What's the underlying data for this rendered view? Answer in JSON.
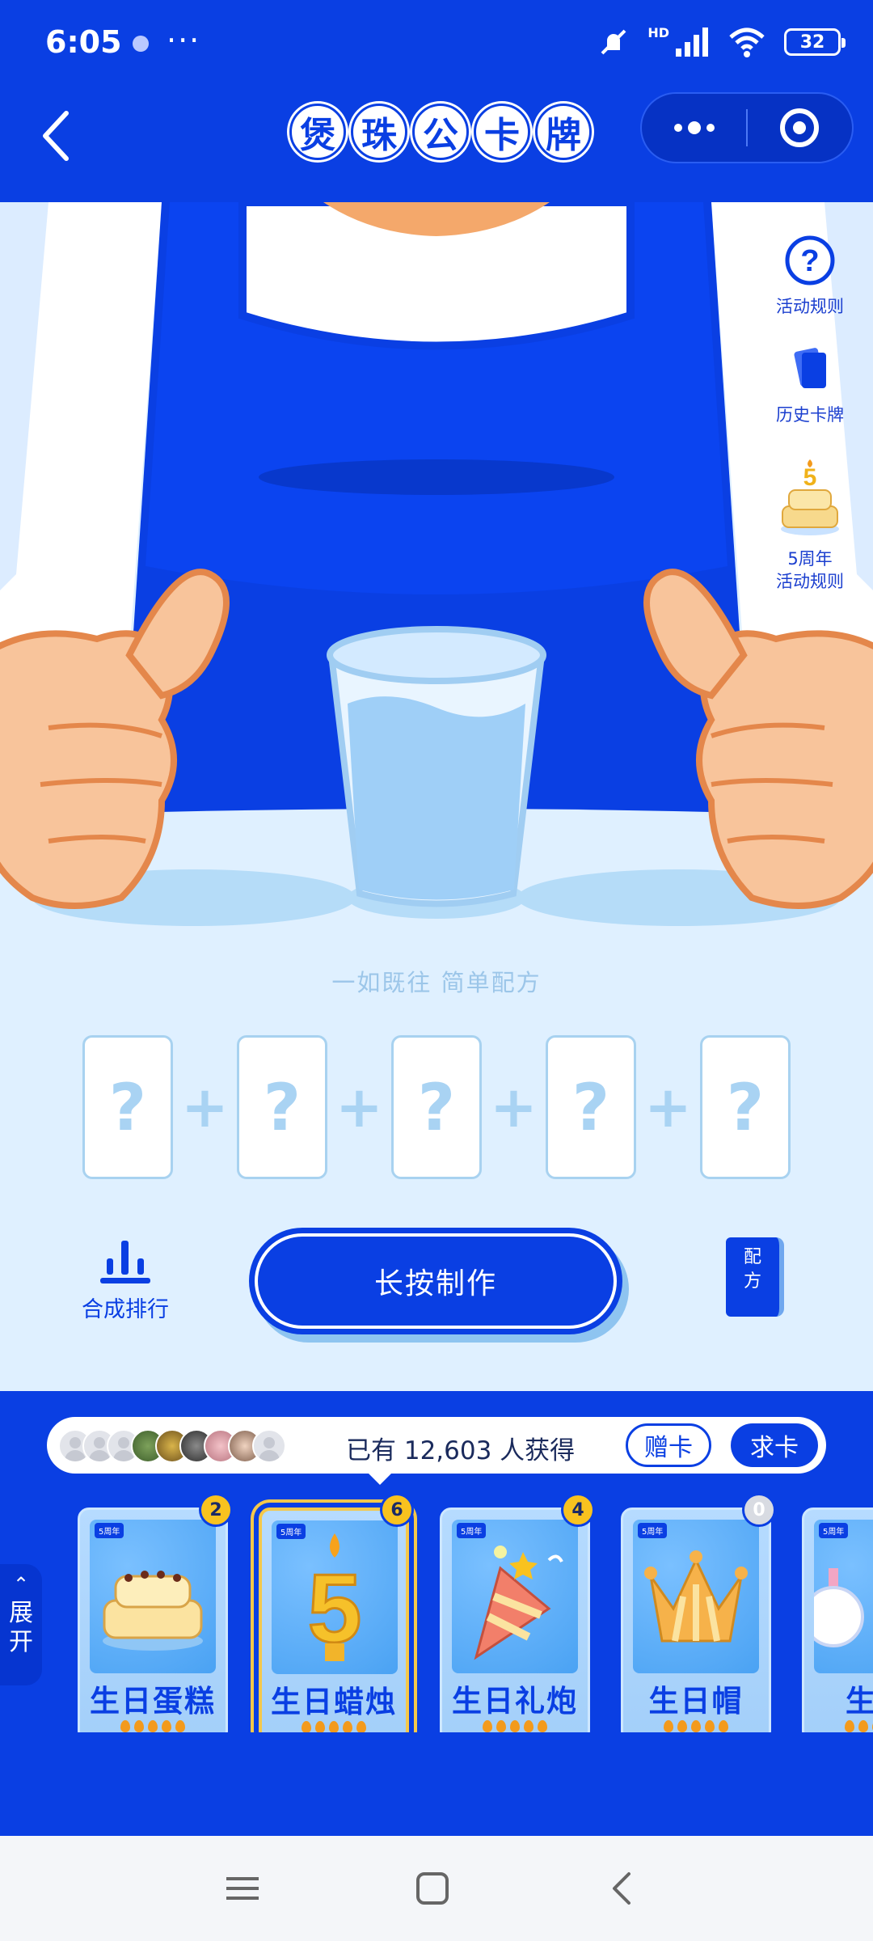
{
  "status_bar": {
    "time": "6:05",
    "more": "···",
    "network_label": "HD",
    "battery": "32"
  },
  "header": {
    "title_chars": [
      "煲",
      "珠",
      "公",
      "卡",
      "牌"
    ]
  },
  "side_menu": [
    {
      "label": "活动规则",
      "icon": "question-icon"
    },
    {
      "label": "历史卡牌",
      "icon": "cards-icon"
    },
    {
      "label_line1": "5周年",
      "label_line2": "活动规则",
      "icon": "cake-icon"
    }
  ],
  "scene": {
    "slogan": "一如既往 简单配方",
    "slots": [
      "?",
      "?",
      "?",
      "?",
      "?"
    ],
    "plus": "+",
    "rank_label": "合成排行",
    "make_label": "长按制作",
    "recipe_label_1": "配",
    "recipe_label_2": "方"
  },
  "obtain": {
    "text": "已有 12,603 人获得",
    "gift_label": "赠卡",
    "ask_label": "求卡"
  },
  "expand": {
    "char1": "展",
    "char2": "开"
  },
  "cards": [
    {
      "name": "生日蛋糕",
      "tag": "5周年",
      "count": "2",
      "icon": "cake-icon"
    },
    {
      "name": "生日蜡烛",
      "tag": "5周年",
      "count": "6",
      "icon": "candle-icon",
      "selected": true
    },
    {
      "name": "生日礼炮",
      "tag": "5周年",
      "count": "4",
      "icon": "party-popper-icon"
    },
    {
      "name": "生日帽",
      "tag": "5周年",
      "count": "0",
      "icon": "crown-hat-icon"
    },
    {
      "name": "生日",
      "tag": "5周年",
      "count": "",
      "icon": "perfume-icon"
    }
  ],
  "colors": {
    "brand_blue": "#0a3fe3",
    "scene_bg": "#dff0ff",
    "badge_yellow": "#f9c21f"
  }
}
